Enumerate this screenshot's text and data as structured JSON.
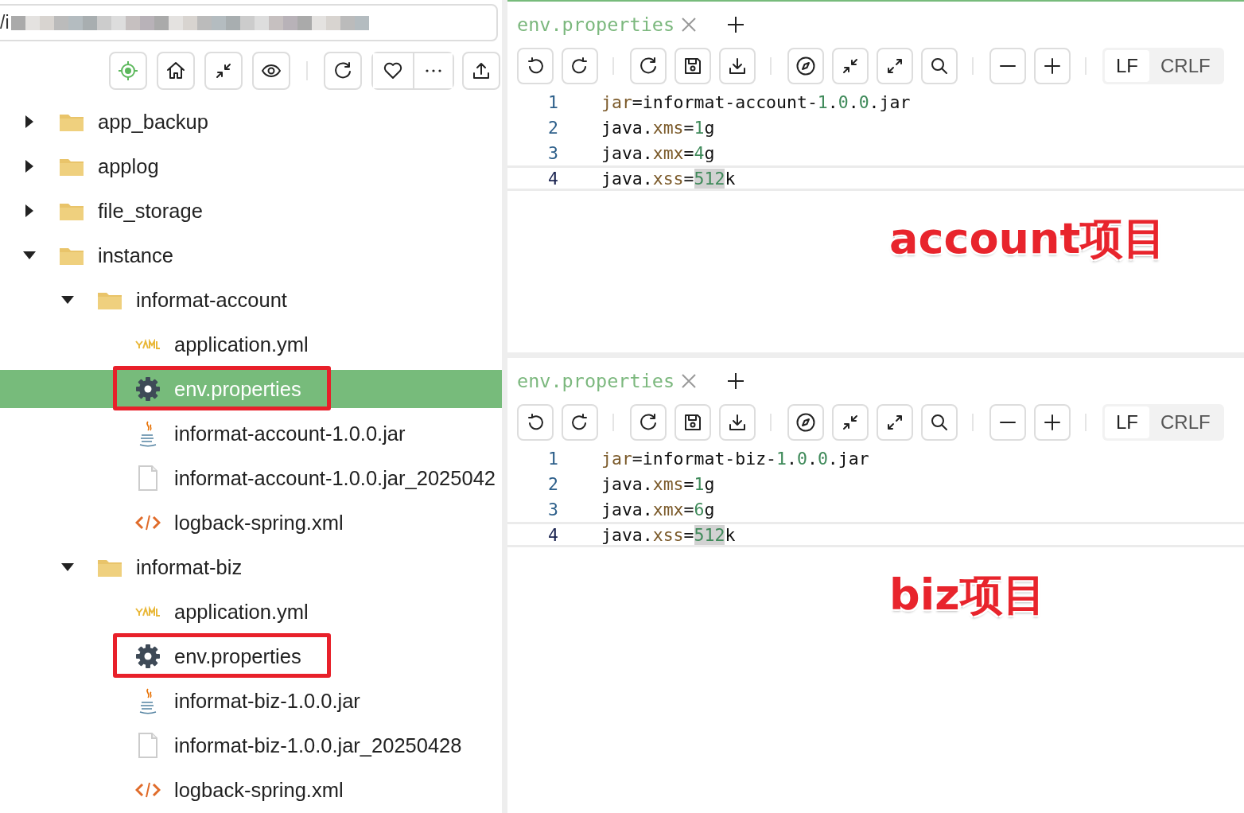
{
  "path_field": {
    "value": "/i"
  },
  "tree": [
    {
      "kind": "folder",
      "label": "app_backup",
      "expanded": false,
      "selected": false,
      "annotated": false
    },
    {
      "kind": "folder",
      "label": "applog",
      "expanded": false,
      "selected": false,
      "annotated": false
    },
    {
      "kind": "folder",
      "label": "file_storage",
      "expanded": false,
      "selected": false,
      "annotated": false
    },
    {
      "kind": "folder",
      "label": "instance",
      "expanded": true,
      "selected": false,
      "annotated": false,
      "children": [
        {
          "kind": "folder",
          "label": "informat-account",
          "expanded": true,
          "selected": false,
          "annotated": false,
          "children": [
            {
              "kind": "yaml",
              "label": "application.yml",
              "selected": false,
              "annotated": false
            },
            {
              "kind": "settings",
              "label": "env.properties",
              "selected": true,
              "annotated": true
            },
            {
              "kind": "java",
              "label": "informat-account-1.0.0.jar",
              "selected": false,
              "annotated": false
            },
            {
              "kind": "file",
              "label": "informat-account-1.0.0.jar_2025042",
              "selected": false,
              "annotated": false
            },
            {
              "kind": "xml",
              "label": "logback-spring.xml",
              "selected": false,
              "annotated": false
            }
          ]
        },
        {
          "kind": "folder",
          "label": "informat-biz",
          "expanded": true,
          "selected": false,
          "annotated": false,
          "children": [
            {
              "kind": "yaml",
              "label": "application.yml",
              "selected": false,
              "annotated": false
            },
            {
              "kind": "settings",
              "label": "env.properties",
              "selected": false,
              "annotated": true
            },
            {
              "kind": "java",
              "label": "informat-biz-1.0.0.jar",
              "selected": false,
              "annotated": false
            },
            {
              "kind": "file",
              "label": "informat-biz-1.0.0.jar_20250428",
              "selected": false,
              "annotated": false
            },
            {
              "kind": "xml",
              "label": "logback-spring.xml",
              "selected": false,
              "annotated": false
            }
          ]
        }
      ]
    }
  ],
  "editors": [
    {
      "tab": {
        "label": "env.properties"
      },
      "line_endings": [
        {
          "label": "LF",
          "selected": true
        },
        {
          "label": "CRLF",
          "selected": false
        }
      ],
      "lines": [
        {
          "number": "1",
          "active": false,
          "tokens": [
            {
              "text": "jar",
              "kind": "key",
              "highlighted": false
            },
            {
              "text": "=informat-account-",
              "kind": "plain",
              "highlighted": false
            },
            {
              "text": "1",
              "kind": "number",
              "highlighted": false
            },
            {
              "text": ".",
              "kind": "plain",
              "highlighted": false
            },
            {
              "text": "0",
              "kind": "number",
              "highlighted": false
            },
            {
              "text": ".",
              "kind": "plain",
              "highlighted": false
            },
            {
              "text": "0",
              "kind": "number",
              "highlighted": false
            },
            {
              "text": ".jar",
              "kind": "plain",
              "highlighted": false
            }
          ]
        },
        {
          "number": "2",
          "active": false,
          "tokens": [
            {
              "text": "java.",
              "kind": "plain",
              "highlighted": false
            },
            {
              "text": "xms",
              "kind": "key",
              "highlighted": false
            },
            {
              "text": "=",
              "kind": "plain",
              "highlighted": false
            },
            {
              "text": "1",
              "kind": "number",
              "highlighted": false
            },
            {
              "text": "g",
              "kind": "plain",
              "highlighted": false
            }
          ]
        },
        {
          "number": "3",
          "active": false,
          "tokens": [
            {
              "text": "java.",
              "kind": "plain",
              "highlighted": false
            },
            {
              "text": "xmx",
              "kind": "key",
              "highlighted": false
            },
            {
              "text": "=",
              "kind": "plain",
              "highlighted": false
            },
            {
              "text": "4",
              "kind": "number",
              "highlighted": false
            },
            {
              "text": "g",
              "kind": "plain",
              "highlighted": false
            }
          ]
        },
        {
          "number": "4",
          "active": true,
          "tokens": [
            {
              "text": "java.",
              "kind": "plain",
              "highlighted": false
            },
            {
              "text": "xss",
              "kind": "key",
              "highlighted": false
            },
            {
              "text": "=",
              "kind": "plain",
              "highlighted": false
            },
            {
              "text": "512",
              "kind": "number",
              "highlighted": true
            },
            {
              "text": "k",
              "kind": "plain",
              "highlighted": false
            }
          ]
        }
      ],
      "annotation": "account项目"
    },
    {
      "tab": {
        "label": "env.properties"
      },
      "line_endings": [
        {
          "label": "LF",
          "selected": true
        },
        {
          "label": "CRLF",
          "selected": false
        }
      ],
      "lines": [
        {
          "number": "1",
          "active": false,
          "tokens": [
            {
              "text": "jar",
              "kind": "key",
              "highlighted": false
            },
            {
              "text": "=informat-biz-",
              "kind": "plain",
              "highlighted": false
            },
            {
              "text": "1",
              "kind": "number",
              "highlighted": false
            },
            {
              "text": ".",
              "kind": "plain",
              "highlighted": false
            },
            {
              "text": "0",
              "kind": "number",
              "highlighted": false
            },
            {
              "text": ".",
              "kind": "plain",
              "highlighted": false
            },
            {
              "text": "0",
              "kind": "number",
              "highlighted": false
            },
            {
              "text": ".jar",
              "kind": "plain",
              "highlighted": false
            }
          ]
        },
        {
          "number": "2",
          "active": false,
          "tokens": [
            {
              "text": "java.",
              "kind": "plain",
              "highlighted": false
            },
            {
              "text": "xms",
              "kind": "key",
              "highlighted": false
            },
            {
              "text": "=",
              "kind": "plain",
              "highlighted": false
            },
            {
              "text": "1",
              "kind": "number",
              "highlighted": false
            },
            {
              "text": "g",
              "kind": "plain",
              "highlighted": false
            }
          ]
        },
        {
          "number": "3",
          "active": false,
          "tokens": [
            {
              "text": "java.",
              "kind": "plain",
              "highlighted": false
            },
            {
              "text": "xmx",
              "kind": "key",
              "highlighted": false
            },
            {
              "text": "=",
              "kind": "plain",
              "highlighted": false
            },
            {
              "text": "6",
              "kind": "number",
              "highlighted": false
            },
            {
              "text": "g",
              "kind": "plain",
              "highlighted": false
            }
          ]
        },
        {
          "number": "4",
          "active": true,
          "tokens": [
            {
              "text": "java.",
              "kind": "plain",
              "highlighted": false
            },
            {
              "text": "xss",
              "kind": "key",
              "highlighted": false
            },
            {
              "text": "=",
              "kind": "plain",
              "highlighted": false
            },
            {
              "text": "512",
              "kind": "number",
              "highlighted": true
            },
            {
              "text": "k",
              "kind": "plain",
              "highlighted": false
            }
          ]
        }
      ],
      "annotation": "biz项目"
    }
  ]
}
